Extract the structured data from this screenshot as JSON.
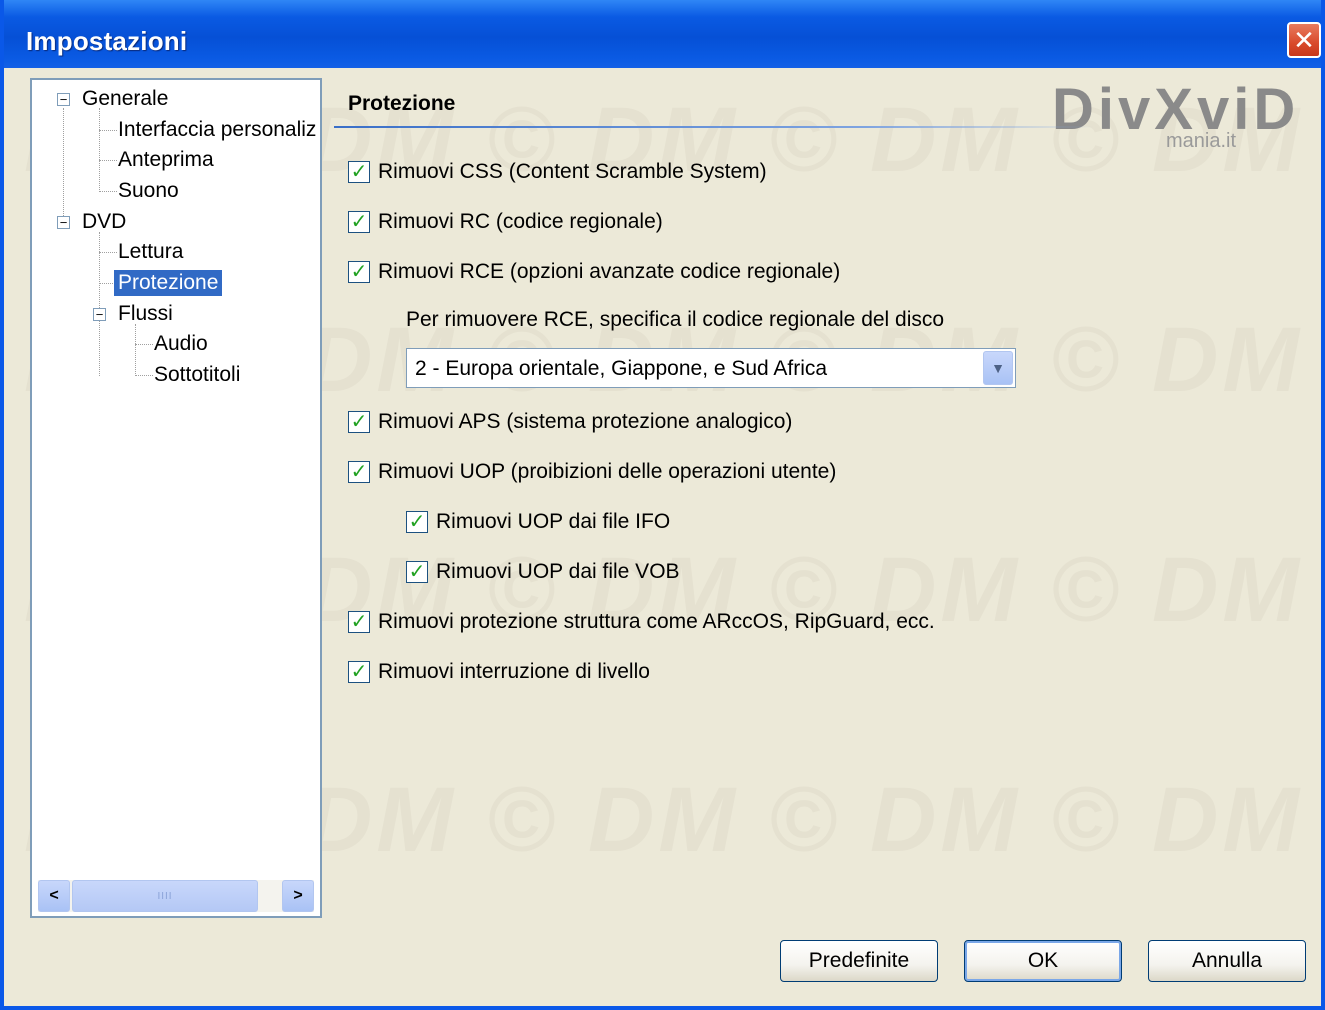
{
  "window": {
    "title": "Impostazioni",
    "close_glyph": "✕"
  },
  "watermark": {
    "text": "DM © DM © DM © DM © DM ©"
  },
  "logo": {
    "main": "DivXviD",
    "sub": "mania.it"
  },
  "tree": {
    "items": [
      {
        "label": "Generale",
        "expander": "−"
      },
      {
        "label": "Interfaccia personaliz"
      },
      {
        "label": "Anteprima"
      },
      {
        "label": "Suono"
      },
      {
        "label": "DVD",
        "expander": "−"
      },
      {
        "label": "Lettura"
      },
      {
        "label": "Protezione"
      },
      {
        "label": "Flussi",
        "expander": "−"
      },
      {
        "label": "Audio"
      },
      {
        "label": "Sottotitoli"
      }
    ],
    "scroll_left": "<",
    "scroll_right": ">",
    "scroll_grip": "IIII"
  },
  "section": {
    "title": "Protezione"
  },
  "options": {
    "css": {
      "label": "Rimuovi CSS (Content Scramble System)",
      "check": "✓"
    },
    "rc": {
      "label": "Rimuovi RC (codice regionale)",
      "check": "✓"
    },
    "rce": {
      "label": "Rimuovi RCE (opzioni avanzate codice regionale)",
      "check": "✓"
    },
    "rce_region_label": "Per rimuovere RCE, specifica il codice regionale del disco",
    "rce_region_value": "2 - Europa orientale, Giappone, e Sud Africa",
    "aps": {
      "label": "Rimuovi APS (sistema protezione analogico)",
      "check": "✓"
    },
    "uop": {
      "label": "Rimuovi UOP (proibizioni delle operazioni utente)",
      "check": "✓"
    },
    "uop_ifo": {
      "label": "Rimuovi UOP dai file IFO",
      "check": "✓"
    },
    "uop_vob": {
      "label": "Rimuovi UOP dai file VOB",
      "check": "✓"
    },
    "structure": {
      "label": "Rimuovi protezione struttura come ARccOS, RipGuard, ecc.",
      "check": "✓"
    },
    "layer_break": {
      "label": "Rimuovi interruzione di livello",
      "check": "✓"
    }
  },
  "buttons": {
    "defaults": "Predefinite",
    "ok": "OK",
    "cancel": "Annulla"
  },
  "colors": {
    "title_bar": "#0a5ae3",
    "selection": "#316ac5",
    "check": "#21a121"
  }
}
